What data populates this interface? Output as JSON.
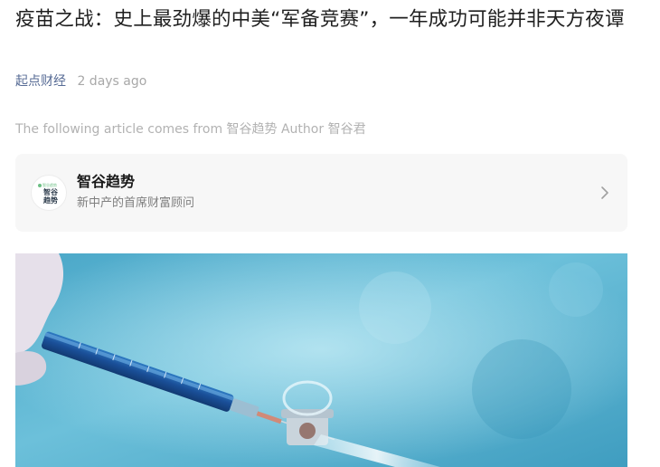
{
  "article": {
    "title": "疫苗之战：史上最劲爆的中美“军备竞赛”，一年成功可能并非天方夜谭",
    "source": "起点财经",
    "time": "2 days ago",
    "from_line": "The following article comes from 智谷趋势 Author 智谷君"
  },
  "account_card": {
    "name": "智谷趋势",
    "description": "新中产的首席财富顾问",
    "avatar_text": "智谷趋势",
    "avatar_mini": "智谷趋势",
    "avatar_icon": "account-logo-icon",
    "chevron_icon": "chevron-right-icon"
  },
  "hero_image": {
    "subject": "vaccine-syringe-image",
    "colors": {
      "background": "#5fb6d2",
      "syringe_blue": "#1f5fae"
    }
  },
  "colors": {
    "link": "#576b95",
    "muted": "#b2b2b2",
    "card": "#f7f7f7"
  }
}
